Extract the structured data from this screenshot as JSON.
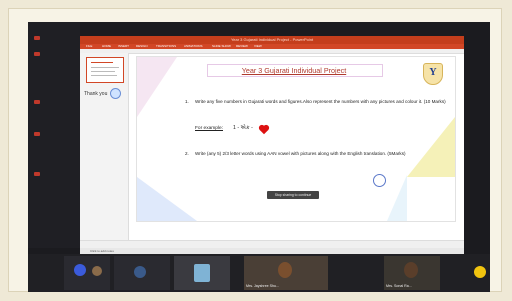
{
  "app": {
    "window_title": "Year 3 Gujarati Individual Project - PowerPoint",
    "ribbon_tabs": [
      "FILE",
      "HOME",
      "INSERT",
      "DESIGN",
      "TRANSITIONS",
      "ANIMATIONS",
      "SLIDE SHOW",
      "REVIEW",
      "VIEW"
    ]
  },
  "sidebar": {
    "thumb_caption": "Thank you"
  },
  "slide": {
    "title": "Year 3 Gujarati Individual Project",
    "logo_letter": "Y",
    "item1_number": "1.",
    "item1_text": "Write any five numbers in Gujarati words and figures.Also represent the numbers with any pictures and colour it. (10 Marks)",
    "example_label": "For example:",
    "example_value": "1 - એક -",
    "item2_number": "2.",
    "item2_text": "Write (any 5) 2/3 letter words using AAN vowel with pictures along with the English translation. (5Marks)",
    "toast": "Stop sharing to continue"
  },
  "notes": {
    "text": "Click to add notes"
  },
  "participants": [
    {
      "name": ""
    },
    {
      "name": ""
    },
    {
      "name": ""
    },
    {
      "name": "Mrs. Jayshree Shu..."
    },
    {
      "name": "Mrs. Sonal Ra..."
    }
  ],
  "colors": {
    "ppt_brand": "#d24726",
    "title_color": "#b03a2e",
    "heart": "#dd1111"
  }
}
